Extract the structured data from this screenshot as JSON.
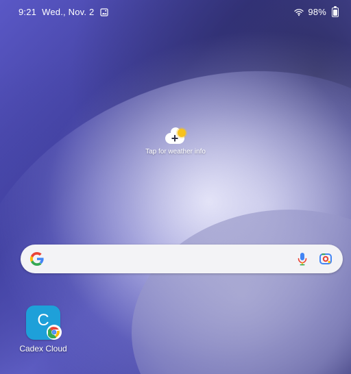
{
  "status_bar": {
    "time": "9:21",
    "date": "Wed., Nov. 2",
    "battery": "98%"
  },
  "weather_widget": {
    "label": "Tap for weather info"
  },
  "search_bar": {
    "left_icon": "google-g-icon",
    "right_icons": [
      "mic-icon",
      "google-lens-icon"
    ]
  },
  "home_apps": [
    {
      "label": "Cadex Cloud",
      "icon_letter": "C",
      "icon_bg": "#1ea0d9",
      "badge": "chrome-icon"
    }
  ]
}
